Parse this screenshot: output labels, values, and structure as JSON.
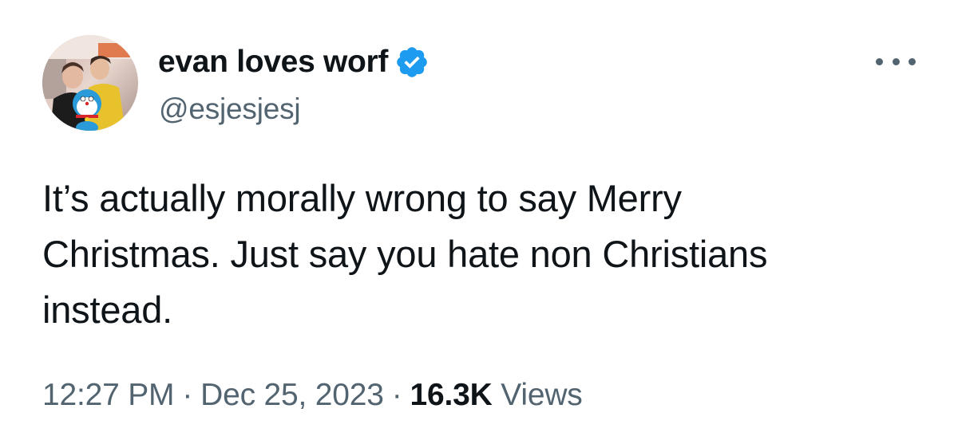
{
  "tweet": {
    "display_name": "evan loves worf",
    "handle": "@esjesjesj",
    "verified": true,
    "text_lines": [
      "It’s actually morally wrong to say Merry",
      "Christmas. Just say you hate non Christians",
      "instead."
    ],
    "time": "12:27 PM",
    "date": "Dec 25, 2023",
    "separator": "·",
    "views_count": "16.3K",
    "views_label": "Views"
  },
  "colors": {
    "verified_badge": "#1d9bf0",
    "secondary_text": "#536471",
    "primary_text": "#0f1419"
  },
  "icons": {
    "verified": "verified-badge-icon",
    "more": "more-options-icon"
  }
}
